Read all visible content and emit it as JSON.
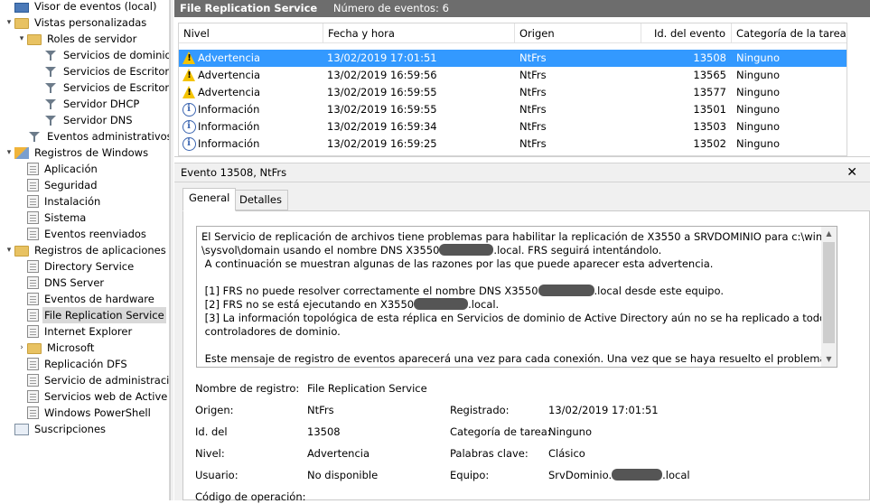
{
  "tree": {
    "items": [
      {
        "label": "Visor de eventos (local)",
        "icon": "event-viewer-icon",
        "expander": ""
      },
      {
        "label": "Vistas personalizadas",
        "icon": "folder-icon",
        "expander": "▾"
      },
      {
        "label": "Roles de servidor",
        "icon": "folder-icon",
        "expander": "▾"
      },
      {
        "label": "Servicios de dominio",
        "icon": "filter-icon",
        "expander": ""
      },
      {
        "label": "Servicios de Escritorio",
        "icon": "filter-icon",
        "expander": ""
      },
      {
        "label": "Servicios de Escritorio",
        "icon": "filter-icon",
        "expander": ""
      },
      {
        "label": "Servidor DHCP",
        "icon": "filter-icon",
        "expander": ""
      },
      {
        "label": "Servidor DNS",
        "icon": "filter-icon",
        "expander": ""
      },
      {
        "label": "Eventos administrativos",
        "icon": "filter-icon",
        "expander": ""
      },
      {
        "label": "Registros de Windows",
        "icon": "windows-logs-icon",
        "expander": "▾"
      },
      {
        "label": "Aplicación",
        "icon": "log-icon",
        "expander": ""
      },
      {
        "label": "Seguridad",
        "icon": "log-icon",
        "expander": ""
      },
      {
        "label": "Instalación",
        "icon": "log-icon",
        "expander": ""
      },
      {
        "label": "Sistema",
        "icon": "log-icon",
        "expander": ""
      },
      {
        "label": "Eventos reenviados",
        "icon": "log-icon",
        "expander": ""
      },
      {
        "label": "Registros de aplicaciones y s",
        "icon": "folder-icon",
        "expander": "▾"
      },
      {
        "label": "Directory Service",
        "icon": "log-icon",
        "expander": ""
      },
      {
        "label": "DNS Server",
        "icon": "log-icon",
        "expander": ""
      },
      {
        "label": "Eventos de hardware",
        "icon": "log-icon",
        "expander": ""
      },
      {
        "label": "File Replication Service",
        "icon": "log-icon",
        "expander": ""
      },
      {
        "label": "Internet Explorer",
        "icon": "log-icon",
        "expander": ""
      },
      {
        "label": "Microsoft",
        "icon": "folder-icon",
        "expander": "›"
      },
      {
        "label": "Replicación DFS",
        "icon": "log-icon",
        "expander": ""
      },
      {
        "label": "Servicio de administració",
        "icon": "log-icon",
        "expander": ""
      },
      {
        "label": "Servicios web de Active D",
        "icon": "log-icon",
        "expander": ""
      },
      {
        "label": "Windows PowerShell",
        "icon": "log-icon",
        "expander": ""
      },
      {
        "label": "Suscripciones",
        "icon": "subscriptions-icon",
        "expander": ""
      }
    ],
    "selected_index": 19
  },
  "events_header": {
    "title": "File Replication Service",
    "count": "Número de eventos: 6"
  },
  "grid": {
    "columns": [
      "Nivel",
      "Fecha y hora",
      "Origen",
      "Id. del evento",
      "Categoría de la tarea"
    ],
    "rows": [
      {
        "level": "Advertencia",
        "level_icon": "warning-icon",
        "datetime": "13/02/2019 17:01:51",
        "source": "NtFrs",
        "id": "13508",
        "category": "Ninguno"
      },
      {
        "level": "Advertencia",
        "level_icon": "warning-icon",
        "datetime": "13/02/2019 16:59:56",
        "source": "NtFrs",
        "id": "13565",
        "category": "Ninguno"
      },
      {
        "level": "Advertencia",
        "level_icon": "warning-icon",
        "datetime": "13/02/2019 16:59:55",
        "source": "NtFrs",
        "id": "13577",
        "category": "Ninguno"
      },
      {
        "level": "Información",
        "level_icon": "info-icon",
        "datetime": "13/02/2019 16:59:55",
        "source": "NtFrs",
        "id": "13501",
        "category": "Ninguno"
      },
      {
        "level": "Información",
        "level_icon": "info-icon",
        "datetime": "13/02/2019 16:59:34",
        "source": "NtFrs",
        "id": "13503",
        "category": "Ninguno"
      },
      {
        "level": "Información",
        "level_icon": "info-icon",
        "datetime": "13/02/2019 16:59:25",
        "source": "NtFrs",
        "id": "13502",
        "category": "Ninguno"
      }
    ],
    "selected_index": 0
  },
  "detail": {
    "header": "Evento 13508, NtFrs",
    "close_label": "✕",
    "tabs": [
      "General",
      "Detalles"
    ],
    "active_tab": 0,
    "description": [
      [
        "El Servicio de replicación de archivos tiene problemas para habilitar la replicación de X3550 a SRVDOMINIO para c:\\windows"
      ],
      [
        "\\sysvol\\domain usando el nombre DNS X3550",
        "█",
        ".local. FRS seguirá intentándolo."
      ],
      [
        " A continuación se muestran algunas de las razones por las que puede aparecer esta advertencia."
      ],
      [
        ""
      ],
      [
        " [1] FRS no puede resolver correctamente el nombre DNS X3550",
        "█",
        ".local desde este equipo."
      ],
      [
        " [2] FRS no se está ejecutando en X3550",
        "█",
        ".local."
      ],
      [
        " [3] La información topológica de esta réplica en Servicios de dominio de Active Directory aún no se ha replicado a todos los"
      ],
      [
        " controladores de dominio."
      ],
      [
        ""
      ],
      [
        " Este mensaje de registro de eventos aparecerá una vez para cada conexión. Una vez que se haya resuelto el problema, volverá a"
      ]
    ],
    "fields": {
      "log_name": {
        "label": "Nombre de registro:",
        "value": "File Replication Service"
      },
      "source": {
        "label": "Origen:",
        "value": "NtFrs"
      },
      "logged": {
        "label": "Registrado:",
        "value": "13/02/2019 17:01:51"
      },
      "event_id": {
        "label": "Id. del",
        "value": "13508"
      },
      "task_category": {
        "label": "Categoría de tarea:",
        "value": "Ninguno"
      },
      "level": {
        "label": "Nivel:",
        "value": "Advertencia"
      },
      "keywords": {
        "label": "Palabras clave:",
        "value": "Clásico"
      },
      "user": {
        "label": "Usuario:",
        "value": "No disponible"
      },
      "computer": {
        "label": "Equipo:",
        "value_prefix": "SrvDominio.",
        "value_suffix": ".local"
      },
      "opcode": {
        "label": "Código de operación:",
        "value": ""
      }
    }
  },
  "colors": {
    "selection": "#3399ff",
    "header_bar": "#6d6d6d",
    "warning": "#f5c400",
    "info": "#3a64b0"
  }
}
